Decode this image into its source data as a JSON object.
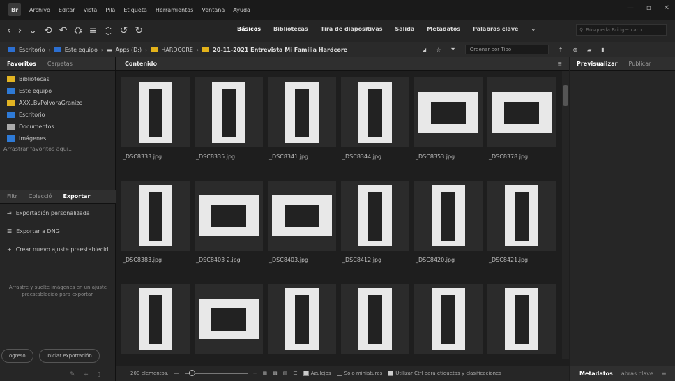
{
  "menubar": {
    "logo": "Br",
    "items": [
      "Archivo",
      "Editar",
      "Vista",
      "Pila",
      "Etiqueta",
      "Herramientas",
      "Ventana",
      "Ayuda"
    ]
  },
  "toolbar": {
    "workspaces": [
      "Básicos",
      "Bibliotecas",
      "Tira de diapositivas",
      "Salida",
      "Metadatos",
      "Palabras clave"
    ],
    "search_placeholder": "Búsqueda Bridge: carp..."
  },
  "path": {
    "crumbs": [
      "Escritorio",
      "Este equipo",
      "Apps (D:)",
      "HARDCORE",
      "20-11-2021 Entrevista Mi Familia Hardcore"
    ],
    "sort_label": "Ordenar por Tipo"
  },
  "left": {
    "tabs": [
      "Favoritos",
      "Carpetas"
    ],
    "favorites": [
      {
        "label": "Bibliotecas",
        "icon": "libraries-icon"
      },
      {
        "label": "Este equipo",
        "icon": "computer-icon"
      },
      {
        "label": "AXXLBvPolvoraGranizo",
        "icon": "folder-icon"
      },
      {
        "label": "Escritorio",
        "icon": "desktop-icon"
      },
      {
        "label": "Documentos",
        "icon": "documents-icon"
      },
      {
        "label": "Imágenes",
        "icon": "pictures-icon"
      }
    ],
    "drag_hint": "Arrastrar favoritos aquí...",
    "export_tabs": [
      "Filtr",
      "Colecció",
      "Exportar"
    ],
    "export_items": [
      "Exportación personalizada",
      "Exportar a DNG",
      "Crear nuevo ajuste preestablecid..."
    ],
    "drop_hint": "Arrastre y suelte imágenes en un ajuste preestablecido para exportar.",
    "progress_btn": "ogreso",
    "start_btn": "Iniciar exportación"
  },
  "content": {
    "title": "Contenido",
    "files": [
      "_DSC8333.jpg",
      "_DSC8335.jpg",
      "_DSC8341.jpg",
      "_DSC8344.jpg",
      "_DSC8353.jpg",
      "_DSC8378.jpg",
      "_DSC8383.jpg",
      "_DSC8403 2.jpg",
      "_DSC8403.jpg",
      "_DSC8412.jpg",
      "_DSC8420.jpg",
      "_DSC8421.jpg",
      "",
      "",
      "",
      "",
      "",
      ""
    ],
    "status": {
      "count": "200 elementos,",
      "tiles_label": "Azulejos",
      "thumbs_only": "Solo miniaturas",
      "ctrl_label": "Utilizar Ctrl para etiquetas y clasificaciones"
    }
  },
  "right": {
    "tabs": [
      "Previsualizar",
      "Publicar"
    ],
    "bottom_tabs": [
      "Metadatos",
      "abras clave"
    ]
  }
}
